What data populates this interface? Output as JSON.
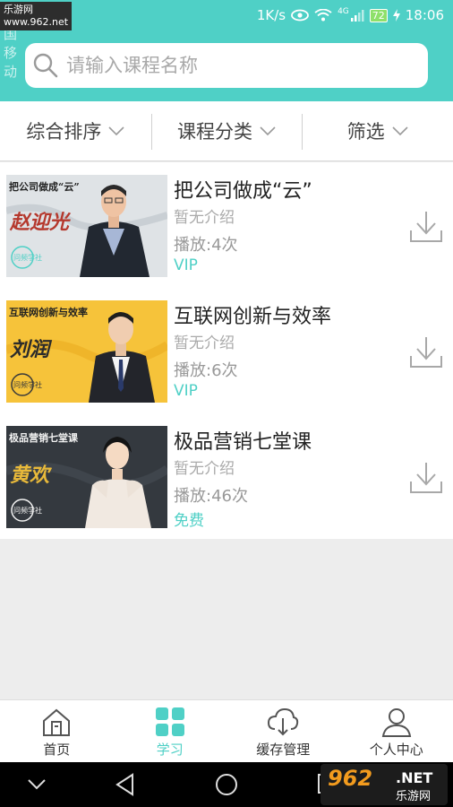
{
  "status_bar": {
    "watermark": "乐游网 www.962.net",
    "carrier": "中国移动",
    "net_speed": "1K/s",
    "network_type": "4G",
    "battery": "72",
    "time": "18:06"
  },
  "search": {
    "placeholder": "请输入课程名称",
    "icon": "search-icon"
  },
  "filters": [
    {
      "label": "综合排序",
      "icon": "chevron-down-icon"
    },
    {
      "label": "课程分类",
      "icon": "chevron-down-icon"
    },
    {
      "label": "筛选",
      "icon": "chevron-down-icon"
    }
  ],
  "courses": [
    {
      "title": "把公司做成“云”",
      "desc": "暂无介绍",
      "plays": "播放:4次",
      "tag": "VIP",
      "thumb_title": "把公司做成“云”",
      "thumb_name": "赵迎光",
      "thumb_logo": "问频学社",
      "thumb_bg": "#dfe3e6"
    },
    {
      "title": "互联网创新与效率",
      "desc": "暂无介绍",
      "plays": "播放:6次",
      "tag": "VIP",
      "thumb_title": "互联网创新与效率",
      "thumb_name": "刘润",
      "thumb_logo": "问频学社",
      "thumb_bg": "#f6c33a"
    },
    {
      "title": "极品营销七堂课",
      "desc": "暂无介绍",
      "plays": "播放:46次",
      "tag": "免费",
      "thumb_title": "极品营销七堂课",
      "thumb_name": "黄欢",
      "thumb_logo": "问频学社",
      "thumb_bg": "#34393f"
    }
  ],
  "tabs": [
    {
      "label": "首页",
      "icon": "home-icon",
      "active": false
    },
    {
      "label": "学习",
      "icon": "grid-icon",
      "active": true
    },
    {
      "label": "缓存管理",
      "icon": "cloud-download-icon",
      "active": false
    },
    {
      "label": "个人中心",
      "icon": "user-icon",
      "active": false
    }
  ],
  "site_logo": {
    "number": "962",
    "net": ".NET",
    "name": "乐游网"
  },
  "colors": {
    "accent": "#4fd0c6",
    "header": "#4fd0c6",
    "background": "#ededed"
  }
}
